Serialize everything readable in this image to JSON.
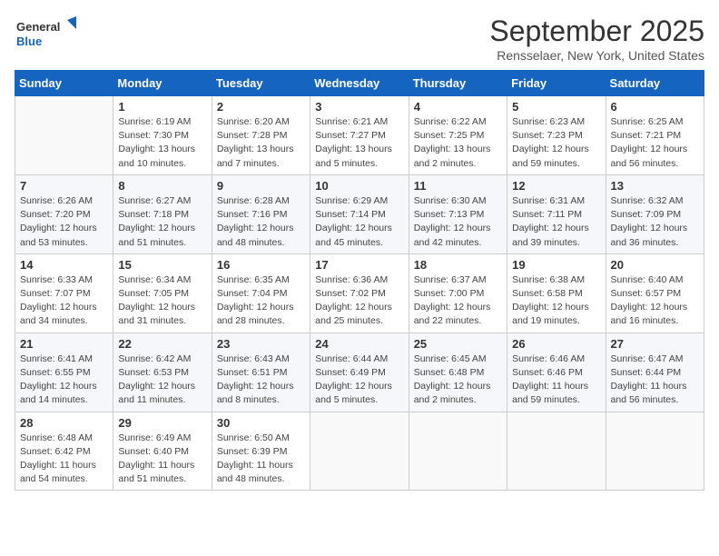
{
  "logo": {
    "line1": "General",
    "line2": "Blue"
  },
  "title": "September 2025",
  "subtitle": "Rensselaer, New York, United States",
  "weekdays": [
    "Sunday",
    "Monday",
    "Tuesday",
    "Wednesday",
    "Thursday",
    "Friday",
    "Saturday"
  ],
  "weeks": [
    [
      {
        "day": "",
        "info": ""
      },
      {
        "day": "1",
        "info": "Sunrise: 6:19 AM\nSunset: 7:30 PM\nDaylight: 13 hours\nand 10 minutes."
      },
      {
        "day": "2",
        "info": "Sunrise: 6:20 AM\nSunset: 7:28 PM\nDaylight: 13 hours\nand 7 minutes."
      },
      {
        "day": "3",
        "info": "Sunrise: 6:21 AM\nSunset: 7:27 PM\nDaylight: 13 hours\nand 5 minutes."
      },
      {
        "day": "4",
        "info": "Sunrise: 6:22 AM\nSunset: 7:25 PM\nDaylight: 13 hours\nand 2 minutes."
      },
      {
        "day": "5",
        "info": "Sunrise: 6:23 AM\nSunset: 7:23 PM\nDaylight: 12 hours\nand 59 minutes."
      },
      {
        "day": "6",
        "info": "Sunrise: 6:25 AM\nSunset: 7:21 PM\nDaylight: 12 hours\nand 56 minutes."
      }
    ],
    [
      {
        "day": "7",
        "info": "Sunrise: 6:26 AM\nSunset: 7:20 PM\nDaylight: 12 hours\nand 53 minutes."
      },
      {
        "day": "8",
        "info": "Sunrise: 6:27 AM\nSunset: 7:18 PM\nDaylight: 12 hours\nand 51 minutes."
      },
      {
        "day": "9",
        "info": "Sunrise: 6:28 AM\nSunset: 7:16 PM\nDaylight: 12 hours\nand 48 minutes."
      },
      {
        "day": "10",
        "info": "Sunrise: 6:29 AM\nSunset: 7:14 PM\nDaylight: 12 hours\nand 45 minutes."
      },
      {
        "day": "11",
        "info": "Sunrise: 6:30 AM\nSunset: 7:13 PM\nDaylight: 12 hours\nand 42 minutes."
      },
      {
        "day": "12",
        "info": "Sunrise: 6:31 AM\nSunset: 7:11 PM\nDaylight: 12 hours\nand 39 minutes."
      },
      {
        "day": "13",
        "info": "Sunrise: 6:32 AM\nSunset: 7:09 PM\nDaylight: 12 hours\nand 36 minutes."
      }
    ],
    [
      {
        "day": "14",
        "info": "Sunrise: 6:33 AM\nSunset: 7:07 PM\nDaylight: 12 hours\nand 34 minutes."
      },
      {
        "day": "15",
        "info": "Sunrise: 6:34 AM\nSunset: 7:05 PM\nDaylight: 12 hours\nand 31 minutes."
      },
      {
        "day": "16",
        "info": "Sunrise: 6:35 AM\nSunset: 7:04 PM\nDaylight: 12 hours\nand 28 minutes."
      },
      {
        "day": "17",
        "info": "Sunrise: 6:36 AM\nSunset: 7:02 PM\nDaylight: 12 hours\nand 25 minutes."
      },
      {
        "day": "18",
        "info": "Sunrise: 6:37 AM\nSunset: 7:00 PM\nDaylight: 12 hours\nand 22 minutes."
      },
      {
        "day": "19",
        "info": "Sunrise: 6:38 AM\nSunset: 6:58 PM\nDaylight: 12 hours\nand 19 minutes."
      },
      {
        "day": "20",
        "info": "Sunrise: 6:40 AM\nSunset: 6:57 PM\nDaylight: 12 hours\nand 16 minutes."
      }
    ],
    [
      {
        "day": "21",
        "info": "Sunrise: 6:41 AM\nSunset: 6:55 PM\nDaylight: 12 hours\nand 14 minutes."
      },
      {
        "day": "22",
        "info": "Sunrise: 6:42 AM\nSunset: 6:53 PM\nDaylight: 12 hours\nand 11 minutes."
      },
      {
        "day": "23",
        "info": "Sunrise: 6:43 AM\nSunset: 6:51 PM\nDaylight: 12 hours\nand 8 minutes."
      },
      {
        "day": "24",
        "info": "Sunrise: 6:44 AM\nSunset: 6:49 PM\nDaylight: 12 hours\nand 5 minutes."
      },
      {
        "day": "25",
        "info": "Sunrise: 6:45 AM\nSunset: 6:48 PM\nDaylight: 12 hours\nand 2 minutes."
      },
      {
        "day": "26",
        "info": "Sunrise: 6:46 AM\nSunset: 6:46 PM\nDaylight: 11 hours\nand 59 minutes."
      },
      {
        "day": "27",
        "info": "Sunrise: 6:47 AM\nSunset: 6:44 PM\nDaylight: 11 hours\nand 56 minutes."
      }
    ],
    [
      {
        "day": "28",
        "info": "Sunrise: 6:48 AM\nSunset: 6:42 PM\nDaylight: 11 hours\nand 54 minutes."
      },
      {
        "day": "29",
        "info": "Sunrise: 6:49 AM\nSunset: 6:40 PM\nDaylight: 11 hours\nand 51 minutes."
      },
      {
        "day": "30",
        "info": "Sunrise: 6:50 AM\nSunset: 6:39 PM\nDaylight: 11 hours\nand 48 minutes."
      },
      {
        "day": "",
        "info": ""
      },
      {
        "day": "",
        "info": ""
      },
      {
        "day": "",
        "info": ""
      },
      {
        "day": "",
        "info": ""
      }
    ]
  ]
}
